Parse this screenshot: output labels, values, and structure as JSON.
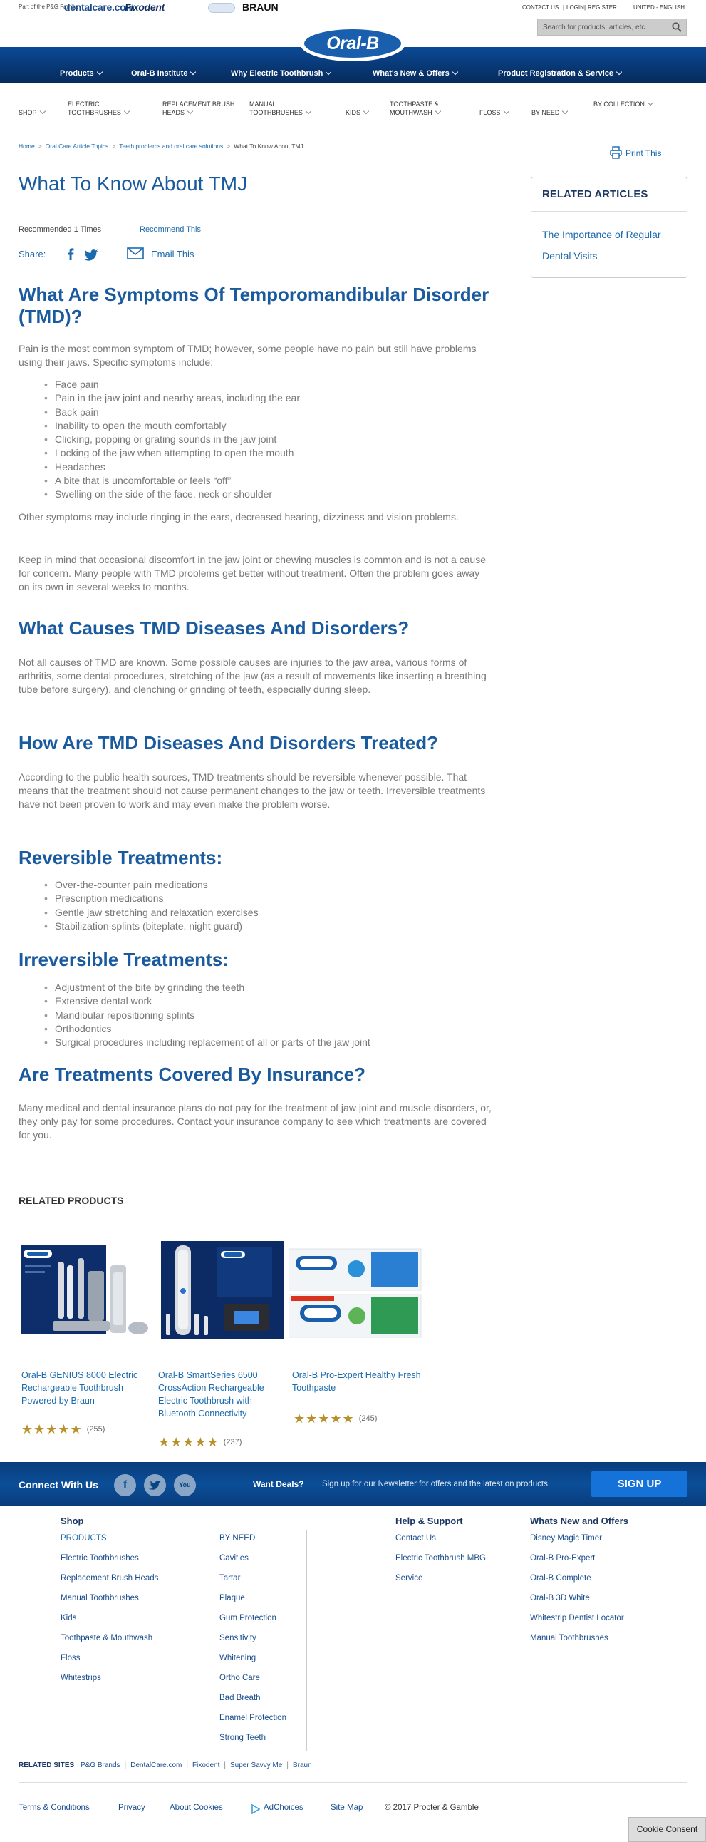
{
  "topbar": {
    "family_label": "Part of the P&G Family:",
    "brands": [
      "dentalcare.com",
      "Fixodent",
      "Crest",
      "BRAUN"
    ],
    "contact": "CONTACT US",
    "login": "LOGIN",
    "register": "REGISTER",
    "locale": "UNITED - ENGLISH",
    "search_placeholder": "Search for products, articles, etc."
  },
  "logo": {
    "text": "Oral-B"
  },
  "main_nav": [
    {
      "label": "Products"
    },
    {
      "label": "Oral-B Institute"
    },
    {
      "label": "Why Electric Toothbrush"
    },
    {
      "label": "What's New & Offers"
    },
    {
      "label": "Product Registration & Service"
    }
  ],
  "sub_nav": [
    {
      "label": "SHOP"
    },
    {
      "label": "ELECTRIC TOOTHBRUSHES"
    },
    {
      "label": "REPLACEMENT BRUSH HEADS"
    },
    {
      "label": "MANUAL TOOTHBRUSHES"
    },
    {
      "label": "KIDS"
    },
    {
      "label": "TOOTHPASTE & MOUTHWASH"
    },
    {
      "label": "FLOSS"
    },
    {
      "label": "BY NEED"
    },
    {
      "label": "BY COLLECTION"
    }
  ],
  "breadcrumb": [
    {
      "label": "Home"
    },
    {
      "label": "Oral Care Article Topics"
    },
    {
      "label": "Teeth problems and oral care solutions"
    },
    {
      "label": "What To Know About TMJ"
    }
  ],
  "print_label": "Print This",
  "article": {
    "title": "What To Know About TMJ",
    "recommended": "Recommended 1 Times",
    "recommend_link": "Recommend This",
    "share_label": "Share:",
    "email_label": "Email This",
    "h_symptoms": "What Are Symptoms Of Temporomandibular Disorder (TMD)?",
    "p_symptoms_intro": "Pain is the most common symptom of TMD; however, some people have no pain but still have problems using their jaws. Specific symptoms include:",
    "symptoms": [
      "Face pain",
      "Pain in the jaw joint and nearby areas, including the ear",
      "Back pain",
      "Inability to open the mouth comfortably",
      "Clicking, popping or grating sounds in the jaw joint",
      "Locking of the jaw when attempting to open the mouth",
      "Headaches",
      "A bite that is uncomfortable or feels “off”",
      "Swelling on the side of the face, neck or shoulder"
    ],
    "p_other_symptoms": "Other symptoms may include ringing in the ears, decreased hearing, dizziness and vision problems.",
    "p_keep_in_mind": "Keep in mind that occasional discomfort in the jaw joint or chewing muscles is common and is not a cause for concern. Many people with TMD problems get better without treatment. Often the problem goes away on its own in several weeks to months.",
    "h_causes": "What Causes TMD Diseases And Disorders?",
    "p_causes": "Not all causes of TMD are known. Some possible causes are injuries to the jaw area, various forms of arthritis, some dental procedures, stretching of the jaw (as a result of movements like inserting a breathing tube before surgery), and clenching or grinding of teeth, especially during sleep.",
    "h_treated": "How Are TMD Diseases And Disorders Treated?",
    "p_treated": "According to the public health sources, TMD treatments should be reversible whenever possible. That means that the treatment should not cause permanent changes to the jaw or teeth. Irreversible treatments have not been proven to work and may even make the problem worse.",
    "h_reversible": "Reversible Treatments:",
    "reversible": [
      "Over-the-counter pain medications",
      "Prescription medications",
      "Gentle jaw stretching and relaxation exercises",
      "Stabilization splints (biteplate, night guard)"
    ],
    "h_irreversible": "Irreversible Treatments:",
    "irreversible": [
      "Adjustment of the bite by grinding the teeth",
      "Extensive dental work",
      "Mandibular repositioning splints",
      "Orthodontics",
      "Surgical procedures including replacement of all or parts of the jaw joint"
    ],
    "h_insurance": "Are Treatments Covered By Insurance?",
    "p_insurance": "Many medical and dental insurance plans do not pay for the treatment of jaw joint and muscle disorders, or, they only pay for some procedures. Contact your insurance company to see which treatments are covered for you."
  },
  "related_articles": {
    "title": "RELATED ARTICLES",
    "items": [
      "The Importance of Regular Dental Visits"
    ]
  },
  "related_products": {
    "title": "RELATED PRODUCTS",
    "items": [
      {
        "name": "Oral-B GENIUS 8000 Electric Rechargeable Toothbrush Powered by Braun",
        "rating": 5,
        "count": "(255)"
      },
      {
        "name": "Oral-B SmartSeries 6500 CrossAction Rechargeable Electric Toothbrush with Bluetooth Connectivity",
        "rating": 5,
        "count": "(237)"
      },
      {
        "name": "Oral-B Pro-Expert Healthy Fresh Toothpaste",
        "rating": 5,
        "count": "(245)"
      }
    ]
  },
  "connect": {
    "label": "Connect With Us",
    "social": [
      "facebook-icon",
      "twitter-icon",
      "youtube-icon"
    ],
    "deals_label": "Want Deals?",
    "newsletter_text": "Sign up for our Newsletter for offers and the latest on products.",
    "signup_label": "SIGN UP"
  },
  "footer": {
    "shop_title": "Shop",
    "shop_products": [
      "PRODUCTS",
      "Electric Toothbrushes",
      "Replacement Brush Heads",
      "Manual Toothbrushes",
      "Kids",
      "Toothpaste & Mouthwash",
      "Floss",
      "Whitestrips"
    ],
    "shop_byneed": [
      "BY NEED",
      "Cavities",
      "Tartar",
      "Plaque",
      "Gum Protection",
      "Sensitivity",
      "Whitening",
      "Ortho Care",
      "Bad Breath",
      "Enamel Protection",
      "Strong Teeth"
    ],
    "help_title": "Help & Support",
    "help": [
      "Contact Us",
      "Electric Toothbrush MBG",
      "Service"
    ],
    "whats_new_title": "Whats New and Offers",
    "whats_new": [
      "Disney Magic Timer",
      "Oral-B Pro-Expert",
      "Oral-B Complete",
      "Oral-B 3D White",
      "Whitestrip Dentist Locator",
      "Manual Toothbrushes"
    ],
    "related_sites_label": "RELATED SITES",
    "related_sites": [
      "P&G Brands",
      "DentalCare.com",
      "Fixodent",
      "Super Savvy Me",
      "Braun"
    ],
    "bottom_links": [
      "Terms & Conditions",
      "Privacy",
      "About Cookies",
      "AdChoices",
      "Site Map"
    ],
    "copyright": "© 2017 Procter & Gamble"
  },
  "cookie_consent": "Cookie Consent"
}
